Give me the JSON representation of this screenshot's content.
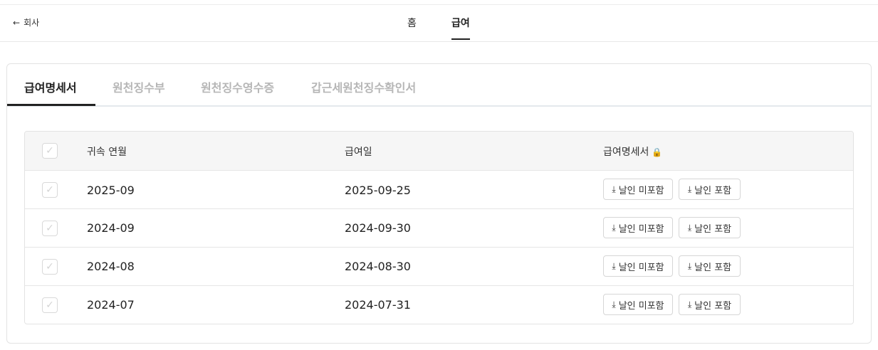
{
  "nav": {
    "back_label": "회사",
    "tabs": [
      {
        "label": "홈"
      },
      {
        "label": "급여"
      }
    ]
  },
  "subtabs": [
    {
      "label": "급여명세서"
    },
    {
      "label": "원천징수부"
    },
    {
      "label": "원천징수영수증"
    },
    {
      "label": "갑근세원천징수확인서"
    }
  ],
  "table": {
    "headers": {
      "period": "귀속 연월",
      "pay_date": "급여일",
      "statement": "급여명세서"
    },
    "rows": [
      {
        "period": "2025-09",
        "pay_date": "2025-09-25"
      },
      {
        "period": "2024-09",
        "pay_date": "2024-09-30"
      },
      {
        "period": "2024-08",
        "pay_date": "2024-08-30"
      },
      {
        "period": "2024-07",
        "pay_date": "2024-07-31"
      }
    ],
    "btn_without_seal": "날인 미포함",
    "btn_with_seal": "날인 포함"
  }
}
